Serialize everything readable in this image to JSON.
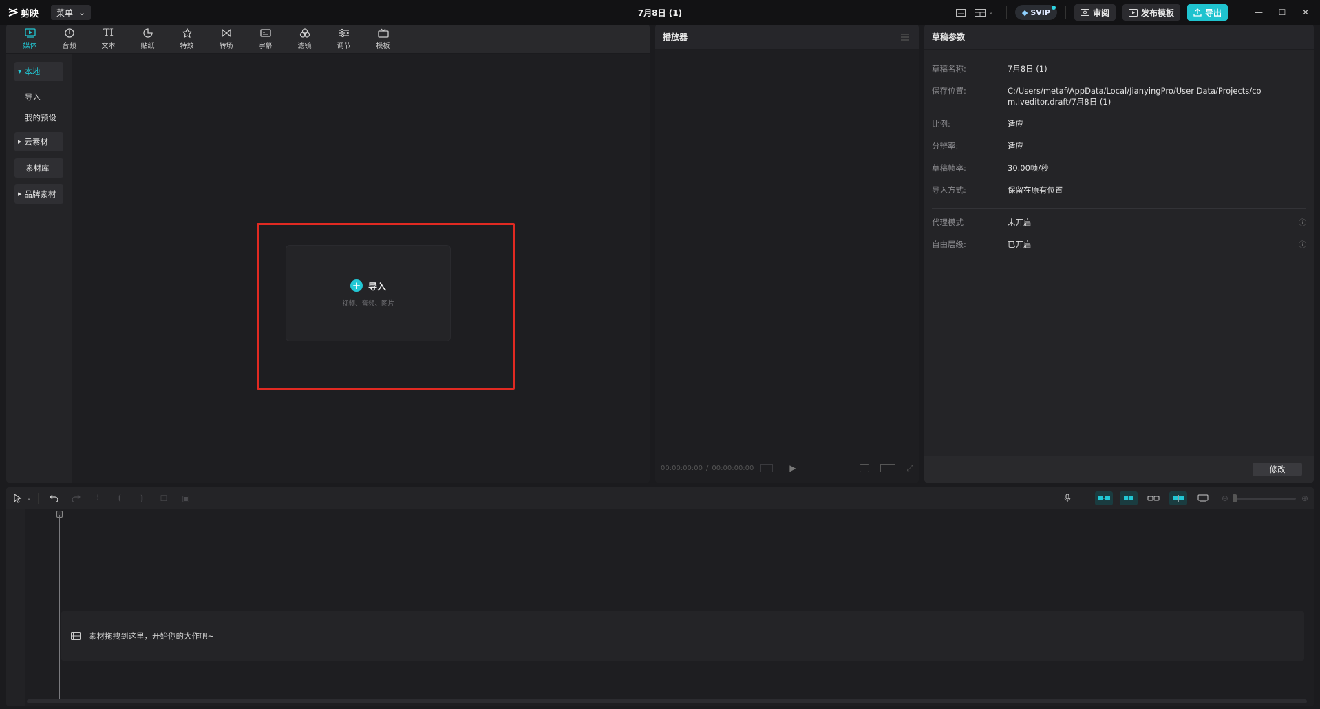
{
  "app": {
    "name": "剪映",
    "menu_label": "菜单",
    "window_title": "7月8日 (1)"
  },
  "titlebar": {
    "svip_label": "SVIP",
    "review_label": "审阅",
    "publish_label": "发布模板",
    "export_label": "导出"
  },
  "tools": [
    {
      "label": "媒体",
      "icon": "media-icon",
      "active": true
    },
    {
      "label": "音频",
      "icon": "audio-icon"
    },
    {
      "label": "文本",
      "icon": "text-icon"
    },
    {
      "label": "贴纸",
      "icon": "sticker-icon"
    },
    {
      "label": "特效",
      "icon": "effects-icon"
    },
    {
      "label": "转场",
      "icon": "transition-icon"
    },
    {
      "label": "字幕",
      "icon": "subtitle-icon"
    },
    {
      "label": "滤镜",
      "icon": "filter-icon"
    },
    {
      "label": "调节",
      "icon": "adjust-icon"
    },
    {
      "label": "模板",
      "icon": "template-icon"
    }
  ],
  "media_sidebar": {
    "local": "本地",
    "import": "导入",
    "my_presets": "我的预设",
    "cloud": "云素材",
    "library": "素材库",
    "brand": "品牌素材"
  },
  "import_card": {
    "label": "导入",
    "hint": "视频、音频、图片"
  },
  "player": {
    "title": "播放器",
    "time_current": "00:00:00:00",
    "time_total": "00:00:00:00"
  },
  "draft": {
    "title": "草稿参数",
    "rows": [
      {
        "key": "草稿名称:",
        "value": "7月8日 (1)"
      },
      {
        "key": "保存位置:",
        "value": "C:/Users/metaf/AppData/Local/JianyingPro/User Data/Projects/com.lveditor.draft/7月8日 (1)"
      },
      {
        "key": "比例:",
        "value": "适应"
      },
      {
        "key": "分辨率:",
        "value": "适应"
      },
      {
        "key": "草稿帧率:",
        "value": "30.00帧/秒"
      },
      {
        "key": "导入方式:",
        "value": "保留在原有位置"
      }
    ],
    "extra_rows": [
      {
        "key": "代理模式",
        "value": "未开启"
      },
      {
        "key": "自由层级:",
        "value": "已开启"
      }
    ],
    "modify_label": "修改"
  },
  "timeline": {
    "drop_hint": "素材拖拽到这里，开始你的大作吧~"
  },
  "colors": {
    "accent": "#22c7d4",
    "highlight": "#e02a22",
    "bg": "#1b1b1e"
  }
}
